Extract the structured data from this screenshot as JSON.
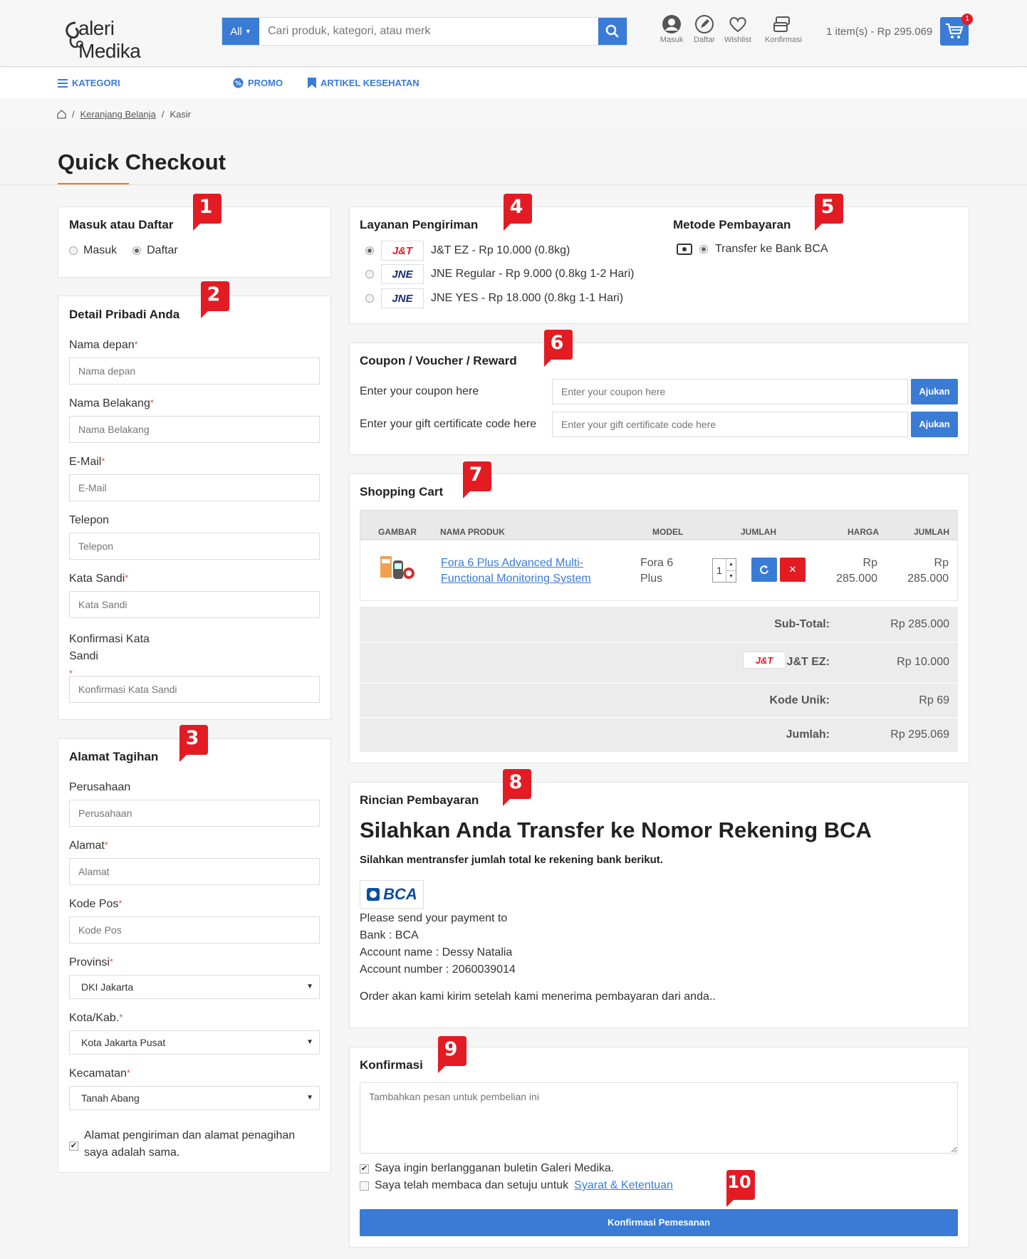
{
  "header": {
    "logo_text": "aleri Medika",
    "search_scope": "All",
    "search_placeholder": "Cari produk, kategori, atau merk",
    "icons": [
      {
        "label": "Masuk",
        "icon": "user-icon"
      },
      {
        "label": "Daftar",
        "icon": "pencil-icon"
      },
      {
        "label": "Wishlist",
        "icon": "heart-icon"
      },
      {
        "label": "Konfirmasi",
        "icon": "payment-icon"
      }
    ],
    "cart_summary": "1 item(s) - Rp 295.069",
    "cart_count": "1"
  },
  "nav": {
    "kategori": "KATEGORI",
    "promo": "PROMO",
    "artikel": "ARTIKEL KESEHATAN"
  },
  "breadcrumb": {
    "cart": "Keranjang Belanja",
    "current": "Kasir"
  },
  "page_title": "Quick Checkout",
  "login": {
    "title": "Masuk atau Daftar",
    "opt_masuk": "Masuk",
    "opt_daftar": "Daftar",
    "selected": "Daftar"
  },
  "personal": {
    "title": "Detail Pribadi Anda",
    "first_name_label": "Nama depan",
    "first_name_ph": "Nama depan",
    "last_name_label": "Nama Belakang",
    "last_name_ph": "Nama Belakang",
    "email_label": "E-Mail",
    "email_ph": "E-Mail",
    "phone_label": "Telepon",
    "phone_ph": "Telepon",
    "password_label": "Kata Sandi",
    "password_ph": "Kata Sandi",
    "confirm_label_1": "Konfirmasi Kata",
    "confirm_label_2": "Sandi",
    "confirm_ph": "Konfirmasi Kata Sandi"
  },
  "billing": {
    "title": "Alamat Tagihan",
    "company_label": "Perusahaan",
    "company_ph": "Perusahaan",
    "address_label": "Alamat",
    "address_ph": "Alamat",
    "postcode_label": "Kode Pos",
    "postcode_ph": "Kode Pos",
    "province_label": "Provinsi",
    "province_value": "DKI Jakarta",
    "city_label": "Kota/Kab.",
    "city_value": "Kota Jakarta Pusat",
    "district_label": "Kecamatan",
    "district_value": "Tanah Abang",
    "same_address_1": "Alamat pengiriman dan alamat penagihan",
    "same_address_2": "saya adalah sama.",
    "same_address_checked": true
  },
  "shipping": {
    "title": "Layanan Pengiriman",
    "options": [
      {
        "logo": "J&T",
        "label": "J&T EZ - Rp 10.000 (0.8kg)",
        "selected": true
      },
      {
        "logo": "JNE",
        "label": "JNE Regular - Rp 9.000 (0.8kg 1-2 Hari)",
        "selected": false
      },
      {
        "logo": "JNE",
        "label": "JNE YES - Rp 18.000 (0.8kg 1-1 Hari)",
        "selected": false
      }
    ]
  },
  "payment": {
    "title": "Metode Pembayaran",
    "option": "Transfer ke Bank BCA"
  },
  "coupon": {
    "title": "Coupon / Voucher / Reward",
    "coupon_label": "Enter your coupon here",
    "coupon_ph": "Enter your coupon here",
    "gift_label": "Enter your gift certificate code here",
    "gift_ph": "Enter your gift certificate code here",
    "apply": "Ajukan"
  },
  "cart": {
    "title": "Shopping Cart",
    "headers": [
      "GAMBAR",
      "NAMA PRODUK",
      "MODEL",
      "JUMLAH",
      "HARGA",
      "JUMLAH"
    ],
    "item": {
      "name_1": "Fora 6 Plus Advanced Multi-",
      "name_2": "Functional Monitoring System",
      "model_1": "Fora 6",
      "model_2": "Plus",
      "qty": "1",
      "price_1": "Rp",
      "price_2": "285.000",
      "total_1": "Rp",
      "total_2": "285.000"
    },
    "subtotal_label": "Sub-Total:",
    "subtotal": "Rp 285.000",
    "shipping_logo": "J&T",
    "shipping_label": "J&T EZ:",
    "shipping_value": "Rp 10.000",
    "unique_label": "Kode Unik:",
    "unique_value": "Rp 69",
    "total_label": "Jumlah:",
    "total_value": "Rp 295.069"
  },
  "payinfo": {
    "title": "Rincian Pembayaran",
    "heading": "Silahkan Anda Transfer ke Nomor Rekening BCA",
    "subheading": "Silahkan mentransfer jumlah total ke rekening bank berikut.",
    "bank_logo": "BCA",
    "line1": "Please send your payment to",
    "line2": "Bank : BCA",
    "line3": "Account name : Dessy Natalia",
    "line4": "Account number : 2060039014",
    "note": "Order akan kami kirim setelah kami menerima pembayaran dari anda.."
  },
  "confirm": {
    "title": "Konfirmasi",
    "message_ph": "Tambahkan pesan untuk pembelian ini",
    "newsletter": "Saya ingin berlangganan buletin Galeri Medika.",
    "newsletter_checked": true,
    "terms_prefix": "Saya telah membaca dan setuju untuk",
    "terms_link": "Syarat & Ketentuan",
    "terms_checked": false,
    "submit": "Konfirmasi Pemesanan"
  },
  "markers": [
    "1",
    "2",
    "3",
    "4",
    "5",
    "6",
    "7",
    "8",
    "9",
    "10"
  ],
  "colors": {
    "accent": "#3a7bd5",
    "marker": "#e31b23",
    "danger": "#e31b23",
    "title_underline": "#e67e22"
  }
}
